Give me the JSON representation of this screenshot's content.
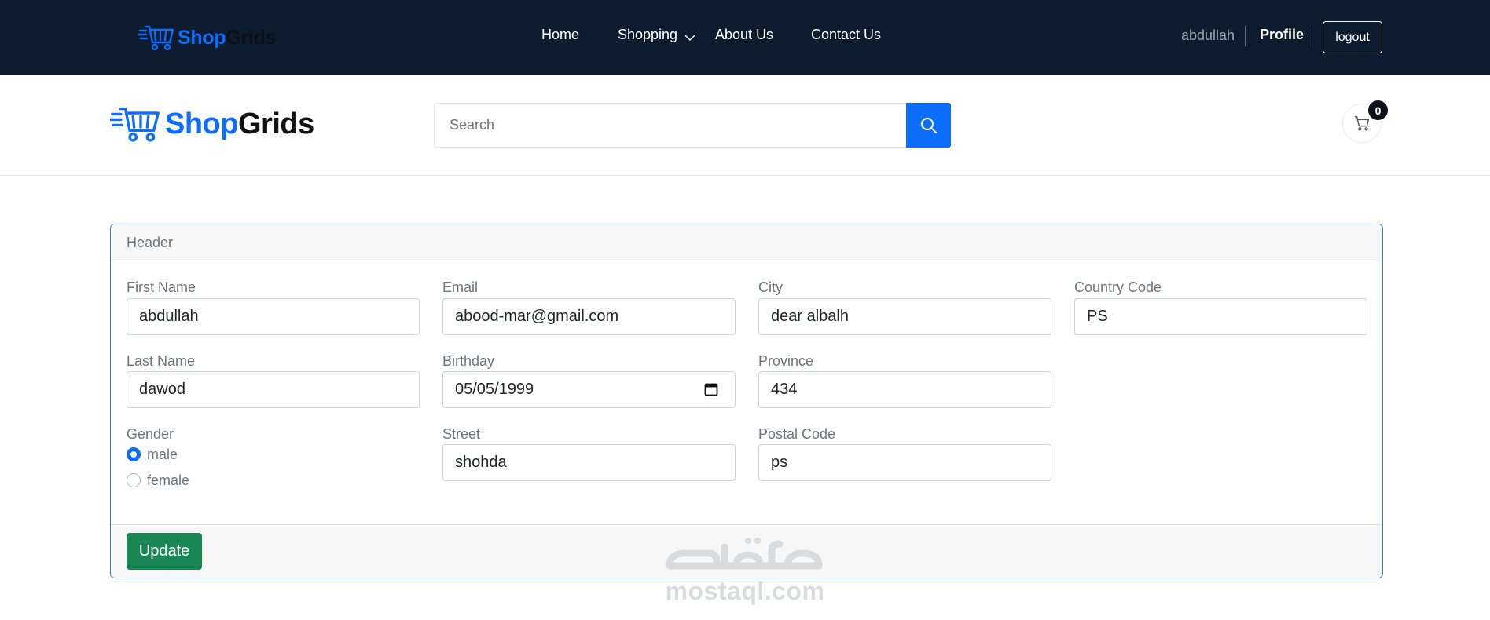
{
  "brand": {
    "name_part1": "Shop",
    "name_part2": "Grids"
  },
  "colors": {
    "topbar_bg": "#0c1b2e",
    "accent": "#0d6efd",
    "success": "#198754"
  },
  "nav": {
    "home": "Home",
    "shopping": "Shopping",
    "about": "About Us",
    "contact": "Contact Us"
  },
  "user": {
    "username": "abdullah",
    "profile": "Profile",
    "logout": "logout"
  },
  "search": {
    "placeholder": "Search",
    "icon": "search-icon"
  },
  "cart": {
    "count": "0",
    "icon": "cart-icon"
  },
  "form": {
    "header": "Header",
    "first_name": {
      "label": "First Name",
      "value": "abdullah"
    },
    "last_name": {
      "label": "Last Name",
      "value": "dawod"
    },
    "email": {
      "label": "Email",
      "value": "abood-mar@gmail.com"
    },
    "birthday": {
      "label": "Birthday",
      "value": "05/05/1999"
    },
    "street": {
      "label": "Street",
      "value": "shohda"
    },
    "city": {
      "label": "City",
      "value": "dear albalh"
    },
    "province": {
      "label": "Province",
      "value": "434"
    },
    "postal_code": {
      "label": "Postal Code",
      "value": "ps"
    },
    "country_code": {
      "label": "Country Code",
      "value": "PS"
    },
    "gender": {
      "label": "Gender",
      "options": [
        {
          "label": "male",
          "checked": true
        },
        {
          "label": "female",
          "checked": false
        }
      ]
    },
    "update_button": "Update"
  },
  "watermark": {
    "text": "mostaql.com"
  }
}
